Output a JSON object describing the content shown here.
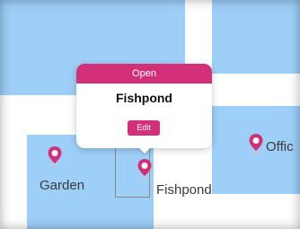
{
  "popup": {
    "header": "Open",
    "title": "Fishpond",
    "edit_label": "Edit"
  },
  "map": {
    "labels": {
      "garden": "Garden",
      "fishpond": "Fishpond",
      "office": "Offic"
    },
    "pins": [
      {
        "name": "garden-pin-icon"
      },
      {
        "name": "fishpond-pin-icon"
      },
      {
        "name": "office-pin-icon"
      }
    ]
  },
  "colors": {
    "accent": "#d2317a",
    "room": "#9ecff8",
    "outline": "#8a8a8a"
  }
}
